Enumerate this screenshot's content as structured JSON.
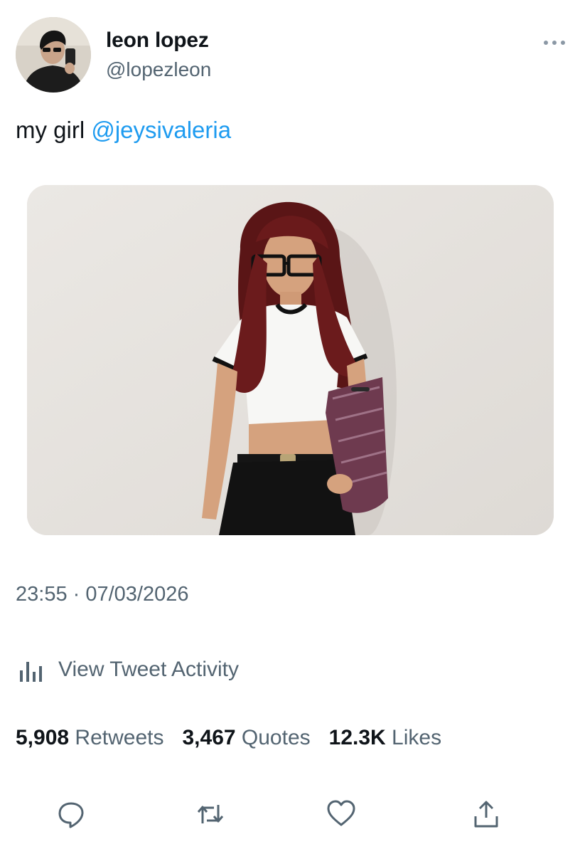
{
  "author": {
    "display_name": "leon lopez",
    "handle": "@lopezleon"
  },
  "tweet": {
    "text": "my girl",
    "mention": "@jeysivaleria",
    "timestamp": "23:55 · 07/03/2026"
  },
  "activity": {
    "label": "View Tweet Activity"
  },
  "stats": {
    "retweets_count": "5,908",
    "retweets_label": "Retweets",
    "quotes_count": "3,467",
    "quotes_label": "Quotes",
    "likes_count": "12.3K",
    "likes_label": "Likes"
  },
  "icons": {
    "more": "more-horizontal-icon",
    "activity": "bar-chart-icon",
    "reply": "reply-icon",
    "retweet": "retweet-icon",
    "like": "heart-icon",
    "share": "share-icon"
  },
  "colors": {
    "text_primary": "#0f1419",
    "text_secondary": "#536471",
    "link": "#1d9bf0"
  }
}
